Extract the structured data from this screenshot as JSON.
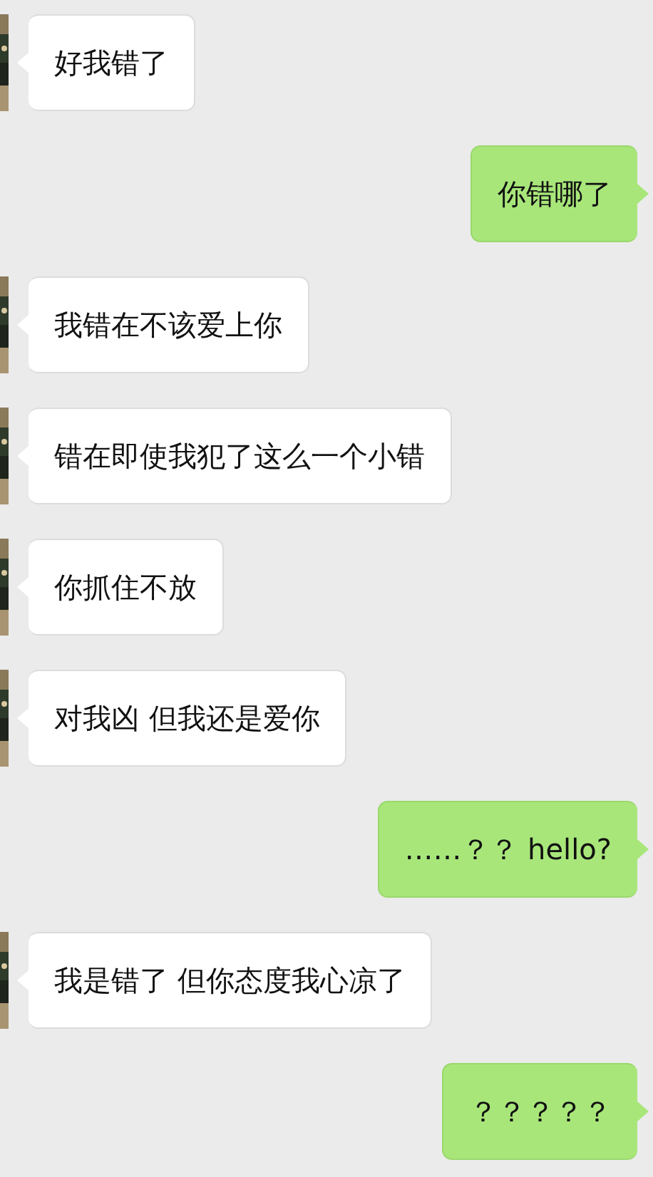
{
  "messages": [
    {
      "kind": "incoming",
      "text": "好我错了"
    },
    {
      "kind": "outgoing",
      "text": "你错哪了"
    },
    {
      "kind": "incoming",
      "text": "我错在不该爱上你"
    },
    {
      "kind": "incoming",
      "text": "错在即使我犯了这么一个小错"
    },
    {
      "kind": "incoming",
      "text": "你抓住不放"
    },
    {
      "kind": "incoming",
      "text": "对我凶 但我还是爱你"
    },
    {
      "kind": "outgoing",
      "text": "……？？ hello?"
    },
    {
      "kind": "incoming",
      "text": "我是错了 但你态度我心凉了"
    },
    {
      "kind": "outgoing",
      "text": "？？？？？"
    }
  ]
}
